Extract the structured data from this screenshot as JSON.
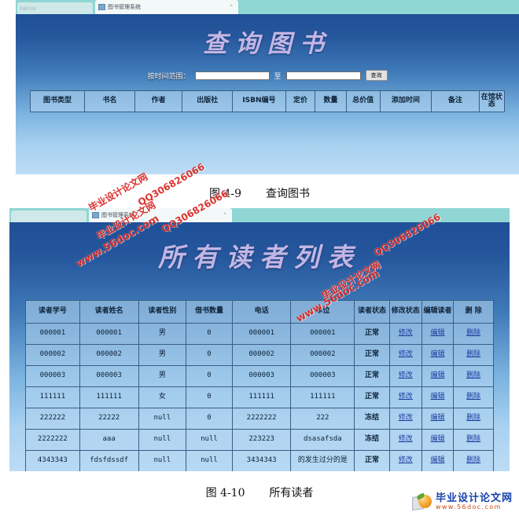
{
  "page": {
    "figures": [
      {
        "number": "图 4-9",
        "title": "查询图书"
      },
      {
        "number": "图 4-10",
        "title": "所有读者"
      }
    ],
    "footer_logo": {
      "name": "毕业设计论文网",
      "url": "www.56doc.com"
    },
    "watermarks": [
      "www.56doc.com",
      "毕业设计论文网",
      "QQ306826066",
      "www.56doc.com",
      "毕业设计论文网",
      "QQ306826066"
    ]
  },
  "shot1": {
    "browser": {
      "prev_tab_text": "login.jsp",
      "tab_title": "图书管理系统",
      "tab_icon": "page-icon",
      "tab_caret": "⌃"
    },
    "app_title": "查询图书",
    "search": {
      "label": "按时间范围：",
      "from_value": "",
      "to_value": "",
      "separator": "至",
      "button": "查询"
    },
    "table": {
      "headers": [
        "图书类型",
        "书名",
        "作者",
        "出版社",
        "ISBN编号",
        "定价",
        "数量",
        "总价值",
        "添加时间",
        "备注",
        "在馆状态"
      ],
      "rows": []
    }
  },
  "shot2": {
    "browser": {
      "prev_tab_text": "",
      "tab_title": "图书管理系统",
      "tab_icon": "page-icon",
      "tab_caret": "⌃"
    },
    "app_title": "所有读者列表",
    "table": {
      "headers": [
        "读者学号",
        "读者姓名",
        "读者性别",
        "借书数量",
        "电话",
        "单位",
        "读者状态",
        "修改状态",
        "编辑读者",
        "删 除"
      ],
      "rows": [
        {
          "id": "000001",
          "name": "000001",
          "sex": "男",
          "borrowed": "0",
          "phone": "000001",
          "unit": "000001",
          "status": "正常",
          "edit_status": "修改",
          "edit_reader": "编辑",
          "delete": "删除"
        },
        {
          "id": "000002",
          "name": "000002",
          "sex": "男",
          "borrowed": "0",
          "phone": "000002",
          "unit": "000002",
          "status": "正常",
          "edit_status": "修改",
          "edit_reader": "编辑",
          "delete": "删除"
        },
        {
          "id": "000003",
          "name": "000003",
          "sex": "男",
          "borrowed": "0",
          "phone": "000003",
          "unit": "000003",
          "status": "正常",
          "edit_status": "修改",
          "edit_reader": "编辑",
          "delete": "删除"
        },
        {
          "id": "111111",
          "name": "111111",
          "sex": "女",
          "borrowed": "0",
          "phone": "111111",
          "unit": "111111",
          "status": "正常",
          "edit_status": "修改",
          "edit_reader": "编辑",
          "delete": "删除"
        },
        {
          "id": "222222",
          "name": "22222",
          "sex": "null",
          "borrowed": "0",
          "phone": "2222222",
          "unit": "222",
          "status": "冻结",
          "edit_status": "修改",
          "edit_reader": "编辑",
          "delete": "删除"
        },
        {
          "id": "2222222",
          "name": "aaa",
          "sex": "null",
          "borrowed": "null",
          "phone": "223223",
          "unit": "dsasafsda",
          "status": "冻结",
          "edit_status": "修改",
          "edit_reader": "编辑",
          "delete": "删除"
        },
        {
          "id": "4343343",
          "name": "fdsfdssdf",
          "sex": "null",
          "borrowed": "null",
          "phone": "3434343",
          "unit": "的发生过分的是",
          "status": "正常",
          "edit_status": "修改",
          "edit_reader": "编辑",
          "delete": "删除"
        }
      ]
    }
  },
  "colors": {
    "header_blue_dark": "#1f4f96",
    "header_blue_light": "#bcdcf6",
    "title_purple": "#c3b6e4",
    "status_ok": "#0a7a2a",
    "status_frozen": "#c0121b",
    "link": "#1e3fa0",
    "watermark_red": "#d8231f",
    "chrome_teal": "#8fd6d4"
  }
}
